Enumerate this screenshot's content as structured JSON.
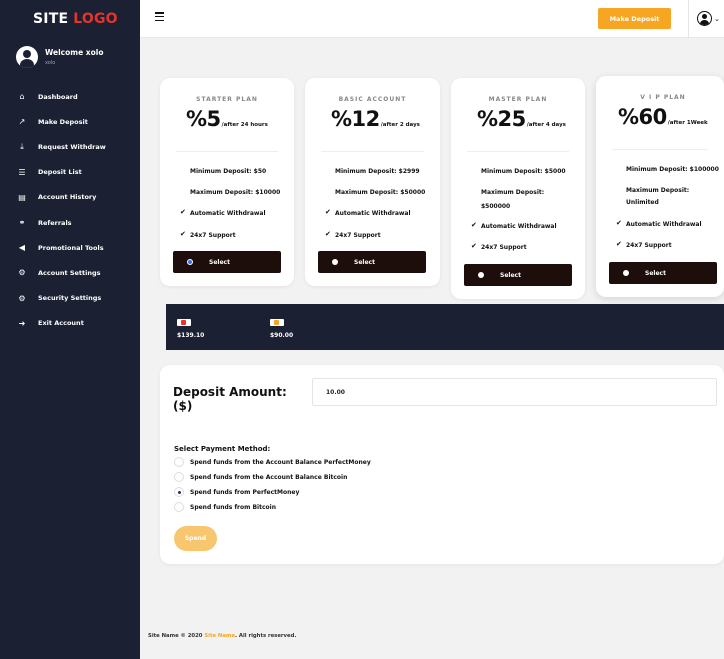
{
  "brand": {
    "logo_a": "SITE",
    "logo_b": "LOGO",
    "accent": "#e8332b"
  },
  "user": {
    "welcome": "Welcome xolo",
    "username": "xolo"
  },
  "sidebar": {
    "items": [
      {
        "label": "Dashboard",
        "icon": "home-icon"
      },
      {
        "label": "Make Deposit",
        "icon": "external-link-icon"
      },
      {
        "label": "Request Withdraw",
        "icon": "download-icon"
      },
      {
        "label": "Deposit List",
        "icon": "list-icon"
      },
      {
        "label": "Account History",
        "icon": "document-list-icon"
      },
      {
        "label": "Referrals",
        "icon": "network-icon"
      },
      {
        "label": "Promotional Tools",
        "icon": "megaphone-icon"
      },
      {
        "label": "Account Settings",
        "icon": "cogs-icon"
      },
      {
        "label": "Security Settings",
        "icon": "gear-icon"
      },
      {
        "label": "Exit Account",
        "icon": "exit-arrow-icon"
      }
    ]
  },
  "header": {
    "make_deposit": "Make Deposit",
    "button_color": "#f6a623"
  },
  "plans": [
    {
      "name": "STARTER PLAN",
      "percent": "%5",
      "after": "/after 24 hours",
      "min": "Minimum Deposit: $50",
      "max": "Maximum Deposit: $10000",
      "f1": "Automatic Withdrawal",
      "f2": "24x7 Support",
      "select": "Select",
      "selected": true
    },
    {
      "name": "BASIC ACCOUNT",
      "percent": "%12",
      "after": "/after 2 days",
      "min": "Minimum Deposit: $2999",
      "max": "Maximum Deposit: $50000",
      "f1": "Automatic Withdrawal",
      "f2": "24x7 Support",
      "select": "Select",
      "selected": false
    },
    {
      "name": "MASTER PLAN",
      "percent": "%25",
      "after": "/after 4 days",
      "min": "Minimum Deposit: $5000",
      "max_line1": "Maximum Deposit:",
      "max_line2": "$500000",
      "f1": "Automatic Withdrawal",
      "f2": "24x7 Support",
      "select": "Select",
      "selected": false
    },
    {
      "name": "V I P PLAN",
      "percent": "%60",
      "after": "/after 1Week",
      "min": "Minimum Deposit: $100000",
      "max_line1": "Maximum Deposit:",
      "max_line2": "Unlimited",
      "f1": "Automatic Withdrawal",
      "f2": "24x7 Support",
      "select": "Select",
      "selected": false
    }
  ],
  "balances": [
    {
      "icon": "perfectmoney-icon",
      "value": "$139.10"
    },
    {
      "icon": "bitcoin-icon",
      "value": "$90.00"
    }
  ],
  "deposit": {
    "label": "Deposit Amount: ($)",
    "amount": "10.00",
    "pm_title": "Select Payment Method:",
    "options": [
      {
        "label": "Spend funds from the Account Balance PerfectMoney",
        "checked": false
      },
      {
        "label": "Spend funds from the Account Balance Bitcoin",
        "checked": false
      },
      {
        "label": "Spend funds from PerfectMoney",
        "checked": true
      },
      {
        "label": "Spend funds from Bitcoin",
        "checked": false
      }
    ],
    "spend": "Spend"
  },
  "footer": {
    "prefix": "Site Name © 2020",
    "link": "Site Name",
    "suffix": ". All rights reserved."
  }
}
